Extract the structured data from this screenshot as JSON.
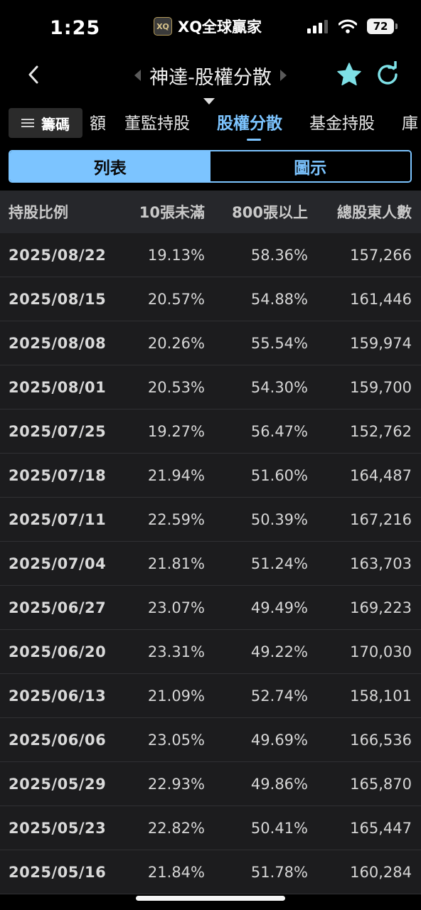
{
  "status_bar": {
    "time": "1:25",
    "app_logo": "XQ",
    "app_name": "XQ全球贏家",
    "battery": "72"
  },
  "header": {
    "title": "神達-股權分散",
    "accent_color": "#7cc4ff",
    "icons": [
      "back-chevron-icon",
      "prev-triangle-icon",
      "next-triangle-icon",
      "star-icon",
      "refresh-icon"
    ]
  },
  "tabs": {
    "chip_label": "籌碼",
    "items": [
      "額",
      "董監持股",
      "股權分散",
      "基金持股",
      "庫"
    ],
    "active_index": 2
  },
  "segment": {
    "options": [
      "列表",
      "圖示"
    ],
    "selected_index": 0
  },
  "table": {
    "headers": [
      "持股比例",
      "10張未滿",
      "800張以上",
      "總股東人數"
    ],
    "rows": [
      [
        "2025/08/22",
        "19.13%",
        "58.36%",
        "157,266"
      ],
      [
        "2025/08/15",
        "20.57%",
        "54.88%",
        "161,446"
      ],
      [
        "2025/08/08",
        "20.26%",
        "55.54%",
        "159,974"
      ],
      [
        "2025/08/01",
        "20.53%",
        "54.30%",
        "159,700"
      ],
      [
        "2025/07/25",
        "19.27%",
        "56.47%",
        "152,762"
      ],
      [
        "2025/07/18",
        "21.94%",
        "51.60%",
        "164,487"
      ],
      [
        "2025/07/11",
        "22.59%",
        "50.39%",
        "167,216"
      ],
      [
        "2025/07/04",
        "21.81%",
        "51.24%",
        "163,703"
      ],
      [
        "2025/06/27",
        "23.07%",
        "49.49%",
        "169,223"
      ],
      [
        "2025/06/20",
        "23.31%",
        "49.22%",
        "170,030"
      ],
      [
        "2025/06/13",
        "21.09%",
        "52.74%",
        "158,101"
      ],
      [
        "2025/06/06",
        "23.05%",
        "49.69%",
        "166,536"
      ],
      [
        "2025/05/29",
        "22.93%",
        "49.86%",
        "165,870"
      ],
      [
        "2025/05/23",
        "22.82%",
        "50.41%",
        "165,447"
      ],
      [
        "2025/05/16",
        "21.84%",
        "51.78%",
        "160,284"
      ]
    ]
  }
}
